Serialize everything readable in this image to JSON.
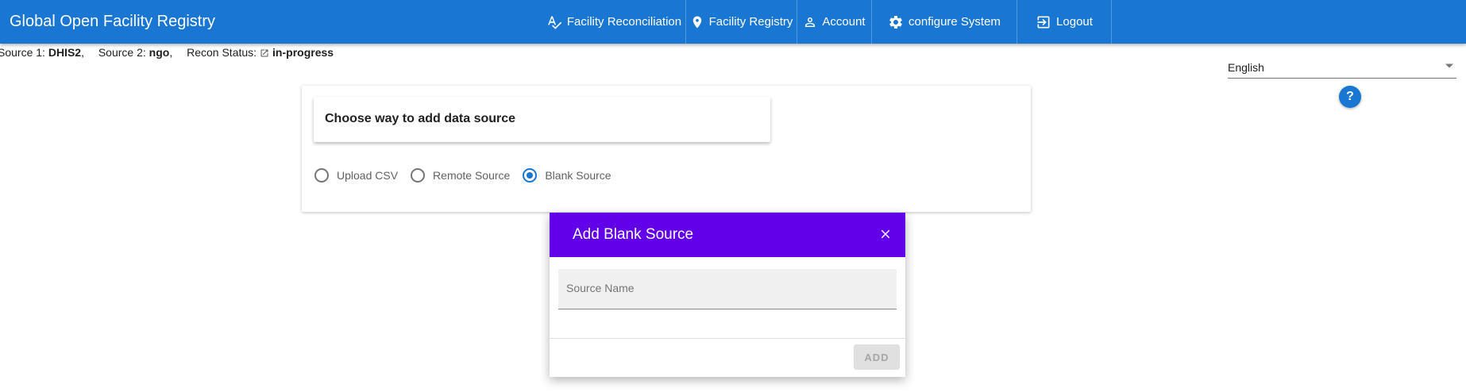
{
  "appbar": {
    "title": "Global Open Facility Registry",
    "nav": {
      "reconciliation": "Facility Reconciliation",
      "registry": "Facility Registry",
      "account": "Account",
      "configure": "configure System",
      "logout": "Logout"
    },
    "icons": {
      "reconciliation": "spellcheck-icon",
      "registry": "location-pin-icon",
      "account": "person-icon",
      "configure": "gear-icon",
      "logout": "logout-icon"
    },
    "color": "#1976d2"
  },
  "source_info": {
    "source1_label": "Source 1:",
    "source1_value": "DHIS2",
    "source2_label": "Source 2:",
    "source2_value": "ngo",
    "recon_label": "Recon Status:",
    "recon_value": "in-progress",
    "separator": ","
  },
  "language": {
    "selected": "English"
  },
  "help": {
    "label": "?"
  },
  "main_card": {
    "title": "Choose way to add data source",
    "options": [
      {
        "label": "Upload CSV",
        "checked": false
      },
      {
        "label": "Remote Source",
        "checked": false
      },
      {
        "label": "Blank Source",
        "checked": true
      }
    ],
    "accent": "#1976d2"
  },
  "dialog": {
    "title": "Add Blank Source",
    "field_label": "Source Name",
    "field_value": "",
    "add_label": "ADD",
    "add_disabled": true,
    "header_color": "#6200ea"
  }
}
